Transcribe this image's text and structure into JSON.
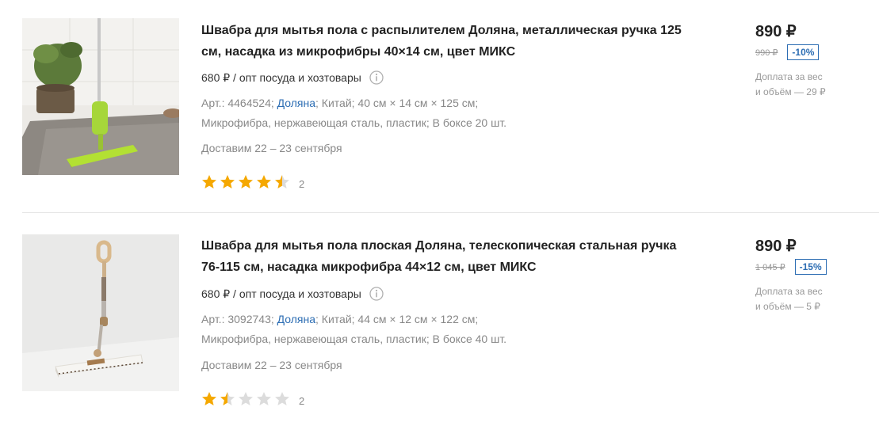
{
  "products": [
    {
      "title": "Швабра для мытья пола с распылителем Доляна, металлическая ручка 125 см, насадка из микрофибры 40×14 см, цвет МИКС",
      "opt_price": "680 ₽ / опт посуда и хозтовары",
      "art": "Арт.: 4464524;",
      "brand": "Доляна",
      "specs_line1_rest": "; Китай; 40 см × 14 см × 125 см;",
      "specs_line2": "Микрофибра, нержавеющая сталь, пластик; В боксе 20 шт.",
      "delivery": "Доставим 22 – 23 сентября",
      "rating": 4.5,
      "reviews": "2",
      "price": "890 ₽",
      "old_price": "990 ₽",
      "discount": "-10%",
      "surcharge_line1": "Доплата за вес",
      "surcharge_line2": "и объём — 29 ₽"
    },
    {
      "title": "Швабра для мытья пола плоская Доляна, телескопическая стальная ручка 76-115 см, насадка микрофибра 44×12 см, цвет МИКС",
      "opt_price": "680 ₽ / опт посуда и хозтовары",
      "art": "Арт.: 3092743;",
      "brand": "Доляна",
      "specs_line1_rest": "; Китай; 44 см × 12 см × 122 см;",
      "specs_line2": "Микрофибра, нержавеющая сталь, пластик; В боксе 40 шт.",
      "delivery": "Доставим 22 – 23 сентября",
      "rating": 1.5,
      "reviews": "2",
      "price": "890 ₽",
      "old_price": "1 045 ₽",
      "discount": "-15%",
      "surcharge_line1": "Доплата за вес",
      "surcharge_line2": "и объём — 5 ₽"
    }
  ],
  "colors": {
    "star_filled": "#f5a800",
    "star_empty": "#dcdcdc",
    "link": "#2c6db3",
    "discount_border": "#2c6db3"
  }
}
